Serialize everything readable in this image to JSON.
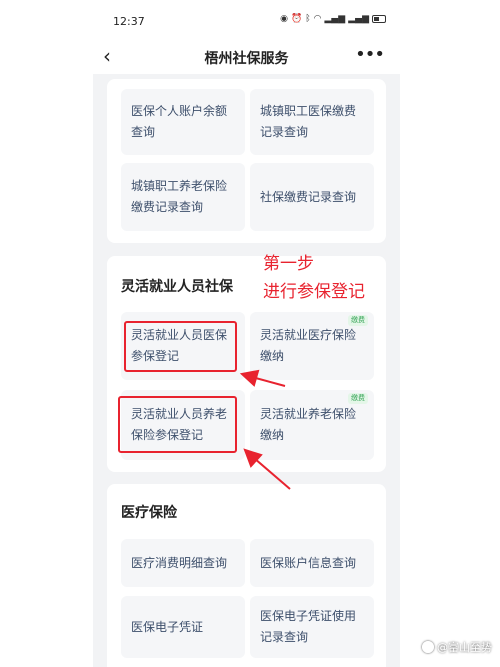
{
  "status_bar": {
    "time": "12:37",
    "icons": [
      "eye-icon",
      "alarm-icon",
      "bluetooth-icon",
      "wifi-icon",
      "signal-icon",
      "signal-icon",
      "battery-icon"
    ]
  },
  "nav": {
    "title": "梧州社保服务",
    "back_icon": "chevron-left-icon",
    "more_icon": "more-icon"
  },
  "top_card": {
    "tiles": [
      {
        "label": "医保个人账户余额查询"
      },
      {
        "label": "城镇职工医保缴费记录查询"
      },
      {
        "label": "城镇职工养老保险缴费记录查询"
      },
      {
        "label": "社保缴费记录查询"
      }
    ]
  },
  "flexible_card": {
    "title": "灵活就业人员社保",
    "tiles": [
      {
        "label": "灵活就业人员医保参保登记"
      },
      {
        "label": "灵活就业医疗保险缴纳",
        "badge": "缴费"
      },
      {
        "label": "灵活就业人员养老保险参保登记"
      },
      {
        "label": "灵活就业养老保险缴纳",
        "badge": "缴费"
      }
    ]
  },
  "medical_card": {
    "title": "医疗保险",
    "tiles": [
      {
        "label": "医疗消费明细查询"
      },
      {
        "label": "医保账户信息查询"
      },
      {
        "label": "医保电子凭证"
      },
      {
        "label": "医保电子凭证使用记录查询"
      }
    ]
  },
  "annotation": {
    "line1": "第一步",
    "line2": "进行参保登记",
    "color": "#e8232f"
  },
  "watermark": {
    "text": "@富山至势"
  }
}
